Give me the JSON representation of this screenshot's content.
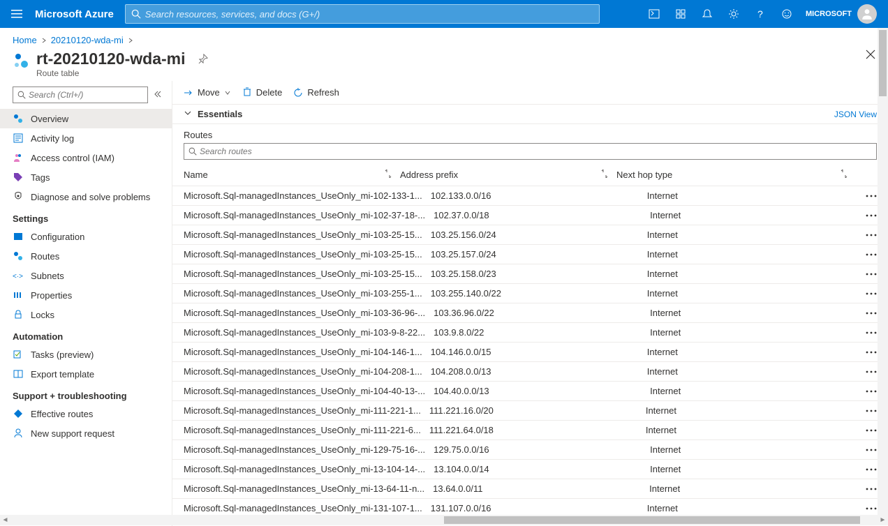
{
  "topbar": {
    "brand": "Microsoft Azure",
    "search_placeholder": "Search resources, services, and docs (G+/)",
    "account_name": "MICROSOFT"
  },
  "breadcrumb": {
    "items": [
      "Home",
      "20210120-wda-mi"
    ]
  },
  "page": {
    "title": "rt-20210120-wda-mi",
    "subtitle": "Route table"
  },
  "sidebar": {
    "search_placeholder": "Search (Ctrl+/)",
    "nav": [
      {
        "label": "Overview",
        "active": true
      },
      {
        "label": "Activity log"
      },
      {
        "label": "Access control (IAM)"
      },
      {
        "label": "Tags"
      },
      {
        "label": "Diagnose and solve problems"
      }
    ],
    "settings_heading": "Settings",
    "settings": [
      {
        "label": "Configuration"
      },
      {
        "label": "Routes"
      },
      {
        "label": "Subnets"
      },
      {
        "label": "Properties"
      },
      {
        "label": "Locks"
      }
    ],
    "automation_heading": "Automation",
    "automation": [
      {
        "label": "Tasks (preview)"
      },
      {
        "label": "Export template"
      }
    ],
    "support_heading": "Support + troubleshooting",
    "support": [
      {
        "label": "Effective routes"
      },
      {
        "label": "New support request"
      }
    ]
  },
  "toolbar": {
    "move": "Move",
    "delete": "Delete",
    "refresh": "Refresh"
  },
  "essentials": {
    "label": "Essentials",
    "json_view": "JSON View"
  },
  "routes": {
    "section_label": "Routes",
    "search_placeholder": "Search routes",
    "columns": {
      "name": "Name",
      "prefix": "Address prefix",
      "hop": "Next hop type"
    },
    "rows": [
      {
        "name": "Microsoft.Sql-managedInstances_UseOnly_mi-102-133-1...",
        "prefix": "102.133.0.0/16",
        "hop": "Internet"
      },
      {
        "name": "Microsoft.Sql-managedInstances_UseOnly_mi-102-37-18-...",
        "prefix": "102.37.0.0/18",
        "hop": "Internet"
      },
      {
        "name": "Microsoft.Sql-managedInstances_UseOnly_mi-103-25-15...",
        "prefix": "103.25.156.0/24",
        "hop": "Internet"
      },
      {
        "name": "Microsoft.Sql-managedInstances_UseOnly_mi-103-25-15...",
        "prefix": "103.25.157.0/24",
        "hop": "Internet"
      },
      {
        "name": "Microsoft.Sql-managedInstances_UseOnly_mi-103-25-15...",
        "prefix": "103.25.158.0/23",
        "hop": "Internet"
      },
      {
        "name": "Microsoft.Sql-managedInstances_UseOnly_mi-103-255-1...",
        "prefix": "103.255.140.0/22",
        "hop": "Internet"
      },
      {
        "name": "Microsoft.Sql-managedInstances_UseOnly_mi-103-36-96-...",
        "prefix": "103.36.96.0/22",
        "hop": "Internet"
      },
      {
        "name": "Microsoft.Sql-managedInstances_UseOnly_mi-103-9-8-22...",
        "prefix": "103.9.8.0/22",
        "hop": "Internet"
      },
      {
        "name": "Microsoft.Sql-managedInstances_UseOnly_mi-104-146-1...",
        "prefix": "104.146.0.0/15",
        "hop": "Internet"
      },
      {
        "name": "Microsoft.Sql-managedInstances_UseOnly_mi-104-208-1...",
        "prefix": "104.208.0.0/13",
        "hop": "Internet"
      },
      {
        "name": "Microsoft.Sql-managedInstances_UseOnly_mi-104-40-13-...",
        "prefix": "104.40.0.0/13",
        "hop": "Internet"
      },
      {
        "name": "Microsoft.Sql-managedInstances_UseOnly_mi-111-221-1...",
        "prefix": "111.221.16.0/20",
        "hop": "Internet"
      },
      {
        "name": "Microsoft.Sql-managedInstances_UseOnly_mi-111-221-6...",
        "prefix": "111.221.64.0/18",
        "hop": "Internet"
      },
      {
        "name": "Microsoft.Sql-managedInstances_UseOnly_mi-129-75-16-...",
        "prefix": "129.75.0.0/16",
        "hop": "Internet"
      },
      {
        "name": "Microsoft.Sql-managedInstances_UseOnly_mi-13-104-14-...",
        "prefix": "13.104.0.0/14",
        "hop": "Internet"
      },
      {
        "name": "Microsoft.Sql-managedInstances_UseOnly_mi-13-64-11-n...",
        "prefix": "13.64.0.0/11",
        "hop": "Internet"
      },
      {
        "name": "Microsoft.Sql-managedInstances_UseOnly_mi-131-107-1...",
        "prefix": "131.107.0.0/16",
        "hop": "Internet"
      }
    ]
  }
}
